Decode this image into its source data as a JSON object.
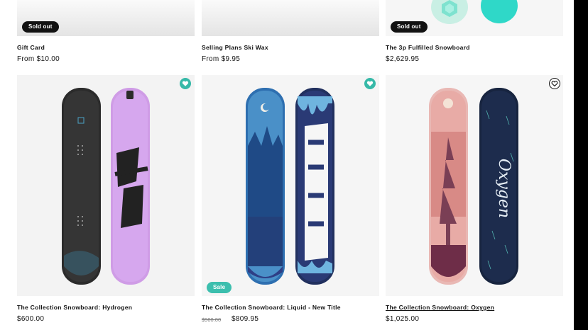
{
  "top_row": [
    {
      "title": "Gift Card",
      "price": "From $10.00",
      "badge": "Sold out"
    },
    {
      "title": "Selling Plans Ski Wax",
      "price": "From $9.95"
    },
    {
      "title": "The 3p Fulfilled Snowboard",
      "price": "$2,629.95",
      "badge": "Sold out"
    }
  ],
  "bottom_row": [
    {
      "title": "The Collection Snowboard: Hydrogen",
      "price": "$600.00",
      "wishlist": "heart-filled-icon"
    },
    {
      "title": "The Collection Snowboard: Liquid - New Title",
      "compare_price": "$900.00",
      "price": "$809.95",
      "badge": "Sale",
      "wishlist": "heart-filled-icon"
    },
    {
      "title": "The Collection Snowboard: Oxygen",
      "price": "$1,025.00",
      "wishlist": "heart-outline-icon"
    }
  ],
  "colors": {
    "sale_badge": "#3cbfae",
    "soldout_badge": "#121212",
    "wishlist_active": "#36b9a8"
  }
}
